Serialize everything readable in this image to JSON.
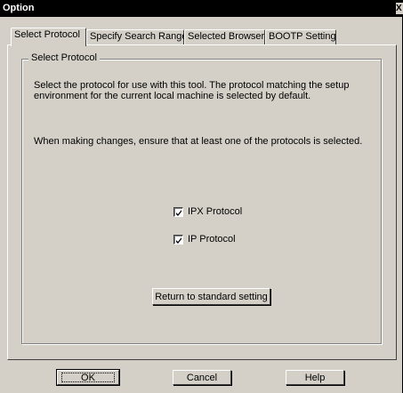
{
  "window": {
    "title": "Option",
    "close_glyph": "X"
  },
  "tabs": [
    {
      "label": "Select Protocol",
      "active": true
    },
    {
      "label": "Specify Search Range",
      "active": false
    },
    {
      "label": "Selected Browser",
      "active": false
    },
    {
      "label": "BOOTP Setting",
      "active": false
    }
  ],
  "group": {
    "legend": "Select Protocol",
    "description_line1": "Select the protocol for use with this tool. The protocol matching the setup",
    "description_line2": "environment for the current local machine is selected by default.",
    "note": "When making changes, ensure that at least one of the protocols is selected."
  },
  "protocols": [
    {
      "label": "IPX Protocol",
      "checked": true
    },
    {
      "label": "IP Protocol",
      "checked": true
    }
  ],
  "buttons": {
    "return_standard": "Return to standard setting",
    "ok": "OK",
    "cancel": "Cancel",
    "help": "Help"
  }
}
